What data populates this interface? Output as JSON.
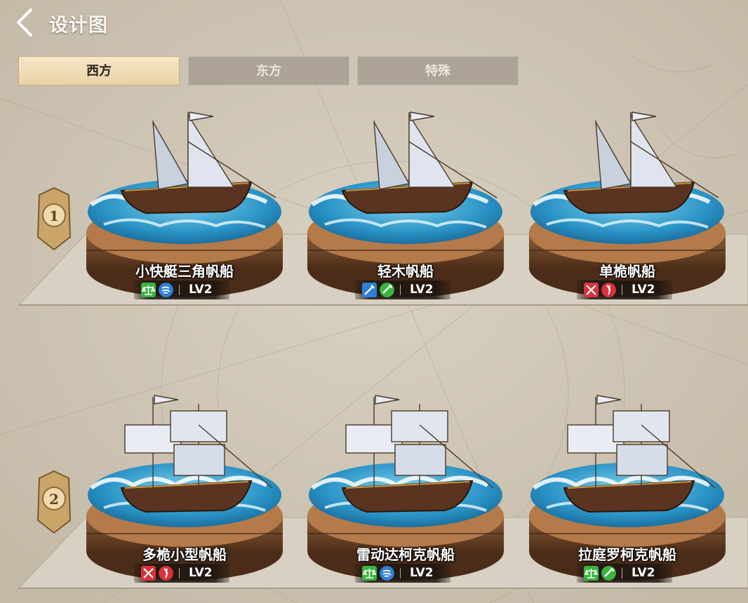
{
  "header": {
    "title": "设计图",
    "back_icon": "back-chevron-icon"
  },
  "tabs": [
    {
      "label": "西方",
      "active": true
    },
    {
      "label": "东方",
      "active": false
    },
    {
      "label": "特殊",
      "active": false
    }
  ],
  "tiers": [
    {
      "number": "1",
      "ships": [
        {
          "name": "小快艇三角帆船",
          "tags": [
            "balance-icon",
            "wind-icon"
          ],
          "level": "LV2"
        },
        {
          "name": "轻木帆船",
          "tags": [
            "sword-icon",
            "repair-icon"
          ],
          "level": "LV2"
        },
        {
          "name": "单桅帆船",
          "tags": [
            "crossed-swords-icon",
            "attack-icon"
          ],
          "level": "LV2"
        }
      ]
    },
    {
      "number": "2",
      "ships": [
        {
          "name": "多桅小型帆船",
          "tags": [
            "crossed-swords-icon",
            "attack-icon"
          ],
          "level": "LV2"
        },
        {
          "name": "雷动达柯克帆船",
          "tags": [
            "balance-icon",
            "wind-icon"
          ],
          "level": "LV2"
        },
        {
          "name": "拉庭罗柯克帆船",
          "tags": [
            "balance-icon",
            "repair-icon"
          ],
          "level": "LV2"
        }
      ]
    }
  ],
  "colors": {
    "active_tab": "#f2dfbd",
    "balance_icon": "#3bb33f",
    "wind_icon": "#2f7fd6",
    "sword_icon": "#2f7fd6",
    "repair_icon": "#3bb33f",
    "crossed_swords_icon": "#d8323b",
    "attack_icon": "#d8323b"
  }
}
